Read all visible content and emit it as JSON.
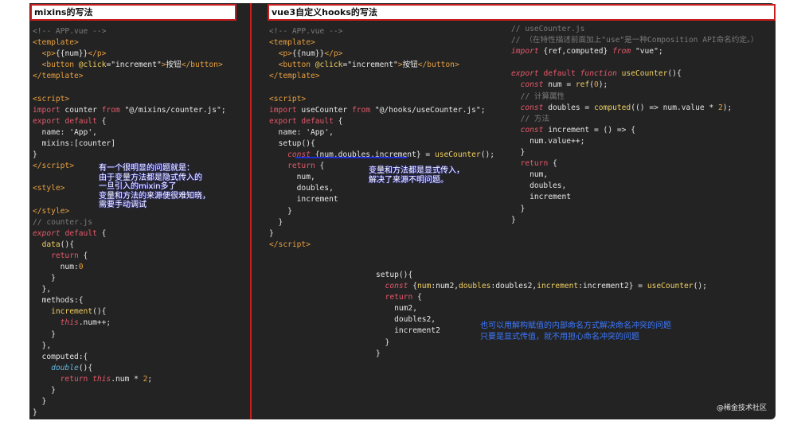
{
  "titles": {
    "left": "mixins的写法",
    "right": "vue3自定义hooks的写法"
  },
  "notes": {
    "left": "有一个很明显的问题就是：\n由于变量方法都是隐式传入的\n一旦引入的mixin多了\n变量和方法的来源便很难知晓，\n需要手动调试",
    "middle": "变量和方法都是显式传入，\n解决了来源不明问题。",
    "bottom": "也可以用解构赋值的内部命名方式解决命名冲突的问题\n只要是显式传值，就不用担心命名冲突的问题"
  },
  "watermark": "@稀金技术社区",
  "colors": {
    "background": "#232323",
    "frame_red": "#c81e1e",
    "comment": "#7a7a7a",
    "tag": "#e8a040",
    "keyword": "#e3596b",
    "function": "#f1d060",
    "string": "#9fd37a",
    "note_blue": "#3c78ff"
  }
}
